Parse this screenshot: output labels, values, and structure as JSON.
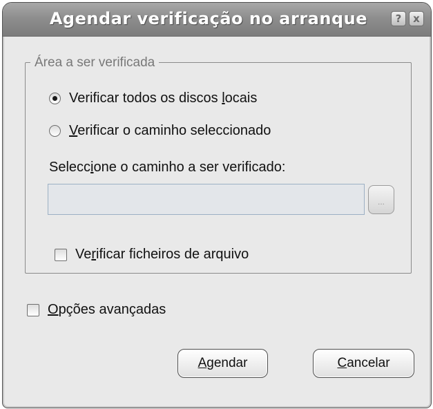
{
  "window": {
    "title": "Agendar verificação no arranque",
    "help_glyph": "?",
    "close_glyph": "x"
  },
  "group": {
    "legend": "Área a ser verificada",
    "radio_all": {
      "pre": "Verificar todos os discos ",
      "ul": "l",
      "post": "ocais",
      "selected": true
    },
    "radio_path": {
      "pre": "",
      "ul": "V",
      "post": "erificar o caminho seleccionado",
      "selected": false
    },
    "path_label": {
      "pre": "Selecc",
      "ul": "i",
      "post": "one o caminho a ser verificado:"
    },
    "path_value": "",
    "browse_label": "...",
    "check_archives": {
      "pre": "Ve",
      "ul": "r",
      "post": "ificar ficheiros de arquivo",
      "checked": false
    }
  },
  "advanced": {
    "pre": "",
    "ul": "O",
    "post": "pções avançadas",
    "checked": false
  },
  "buttons": {
    "agendar": {
      "pre": "",
      "ul": "A",
      "post": "gendar"
    },
    "cancelar": {
      "pre": "",
      "ul": "C",
      "post": "ancelar"
    }
  }
}
